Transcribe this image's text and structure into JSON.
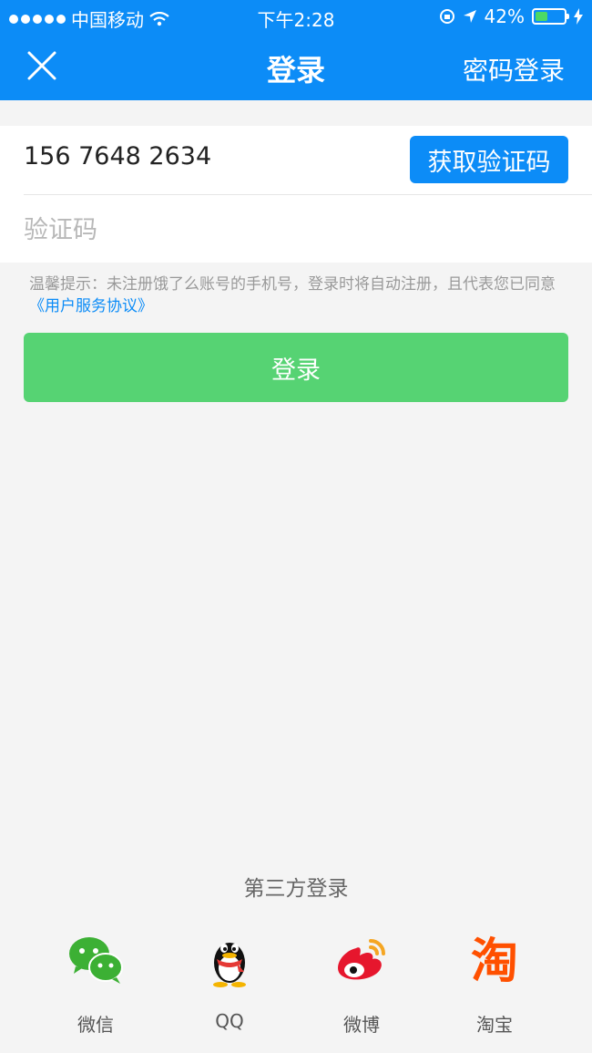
{
  "status_bar": {
    "carrier": "中国移动",
    "time": "下午2:28",
    "battery_text": "42%",
    "battery_level": 0.42
  },
  "nav": {
    "title": "登录",
    "right_action": "密码登录",
    "close_icon": "close-icon"
  },
  "form": {
    "phone_value": "156 7648 2634",
    "get_code_label": "获取验证码",
    "code_placeholder": "验证码"
  },
  "tip": {
    "text": "温馨提示：未注册饿了么账号的手机号，登录时将自动注册，且代表您已同意",
    "link": "《用户服务协议》"
  },
  "login_button": "登录",
  "third_party": {
    "title": "第三方登录",
    "items": [
      {
        "label": "微信",
        "icon": "wechat-icon"
      },
      {
        "label": "QQ",
        "icon": "qq-icon"
      },
      {
        "label": "微博",
        "icon": "weibo-icon"
      },
      {
        "label": "淘宝",
        "icon": "taobao-icon"
      }
    ]
  },
  "colors": {
    "primary": "#0c8cf7",
    "login_green": "#56d373",
    "background": "#f4f4f4"
  }
}
